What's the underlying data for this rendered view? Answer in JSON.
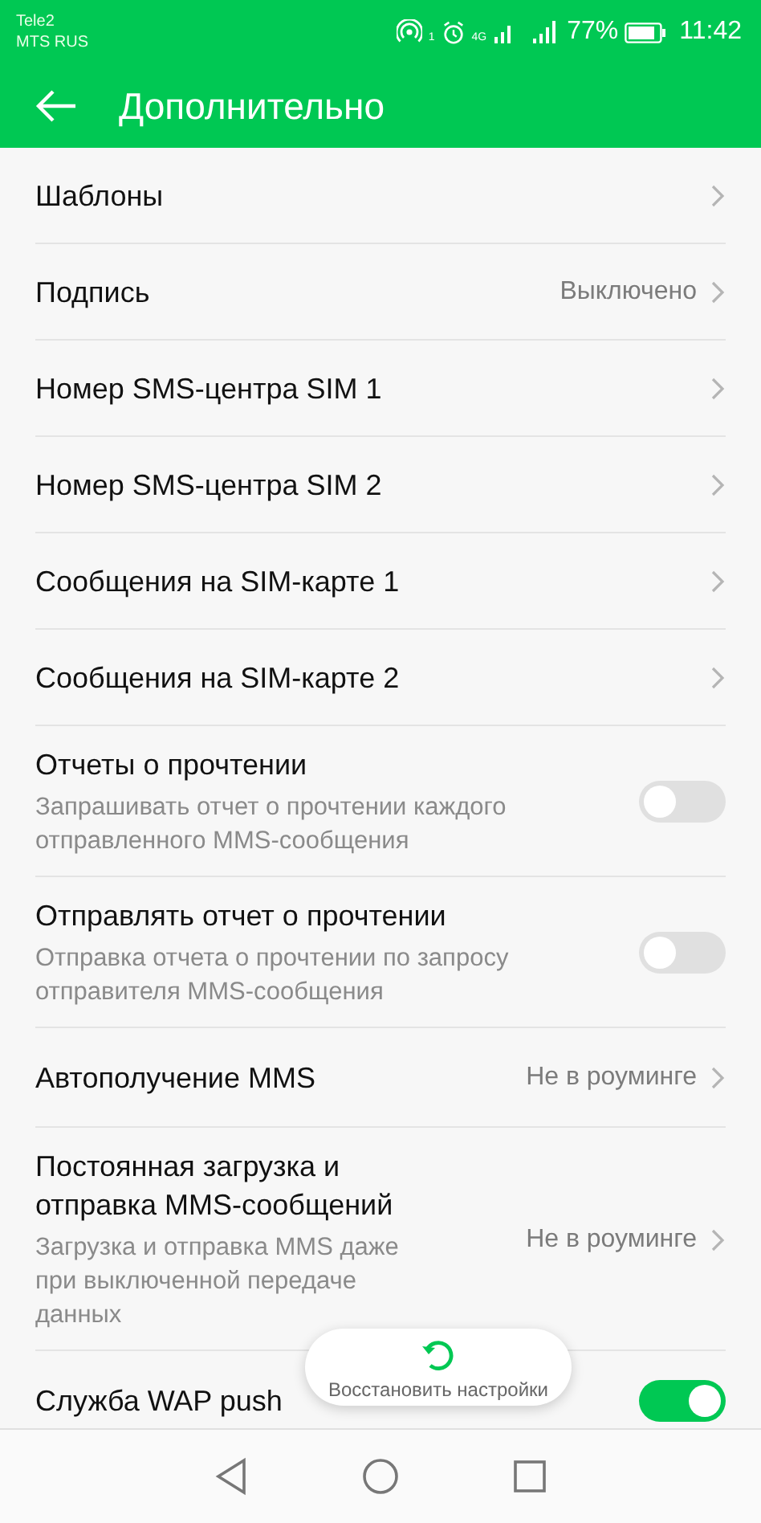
{
  "status_bar": {
    "carriers": [
      "Tele2",
      "MTS RUS"
    ],
    "hotspot_count": "1",
    "network": "4G",
    "battery": "77%",
    "time": "11:42"
  },
  "toolbar": {
    "title": "Дополнительно"
  },
  "settings": [
    {
      "kind": "link",
      "title": "Шаблоны"
    },
    {
      "kind": "link",
      "title": "Подпись",
      "value": "Выключено"
    },
    {
      "kind": "link",
      "title": "Номер SMS-центра SIM 1"
    },
    {
      "kind": "link",
      "title": "Номер SMS-центра SIM 2"
    },
    {
      "kind": "link",
      "title": "Сообщения на SIM-карте 1"
    },
    {
      "kind": "link",
      "title": "Сообщения на SIM-карте 2"
    },
    {
      "kind": "toggle",
      "title": "Отчеты о прочтении",
      "subtitle": "Запрашивать отчет о прочтении каждого отправленного MMS-сообщения",
      "on": false
    },
    {
      "kind": "toggle",
      "title": "Отправлять отчет о прочтении",
      "subtitle": "Отправка отчета о прочтении по запросу отправителя MMS-сообщения",
      "on": false
    },
    {
      "kind": "link",
      "title": "Автополучение MMS",
      "value": "Не в роуминге"
    },
    {
      "kind": "link",
      "title": "Постоянная загрузка и отправка MMS-сообщений",
      "subtitle": "Загрузка и отправка MMS даже при выключенной передаче данных",
      "value": "Не в роуминге"
    },
    {
      "kind": "toggle",
      "title": "Служба WAP push",
      "on": true
    }
  ],
  "restore_button": {
    "label": "Восстановить настройки"
  }
}
